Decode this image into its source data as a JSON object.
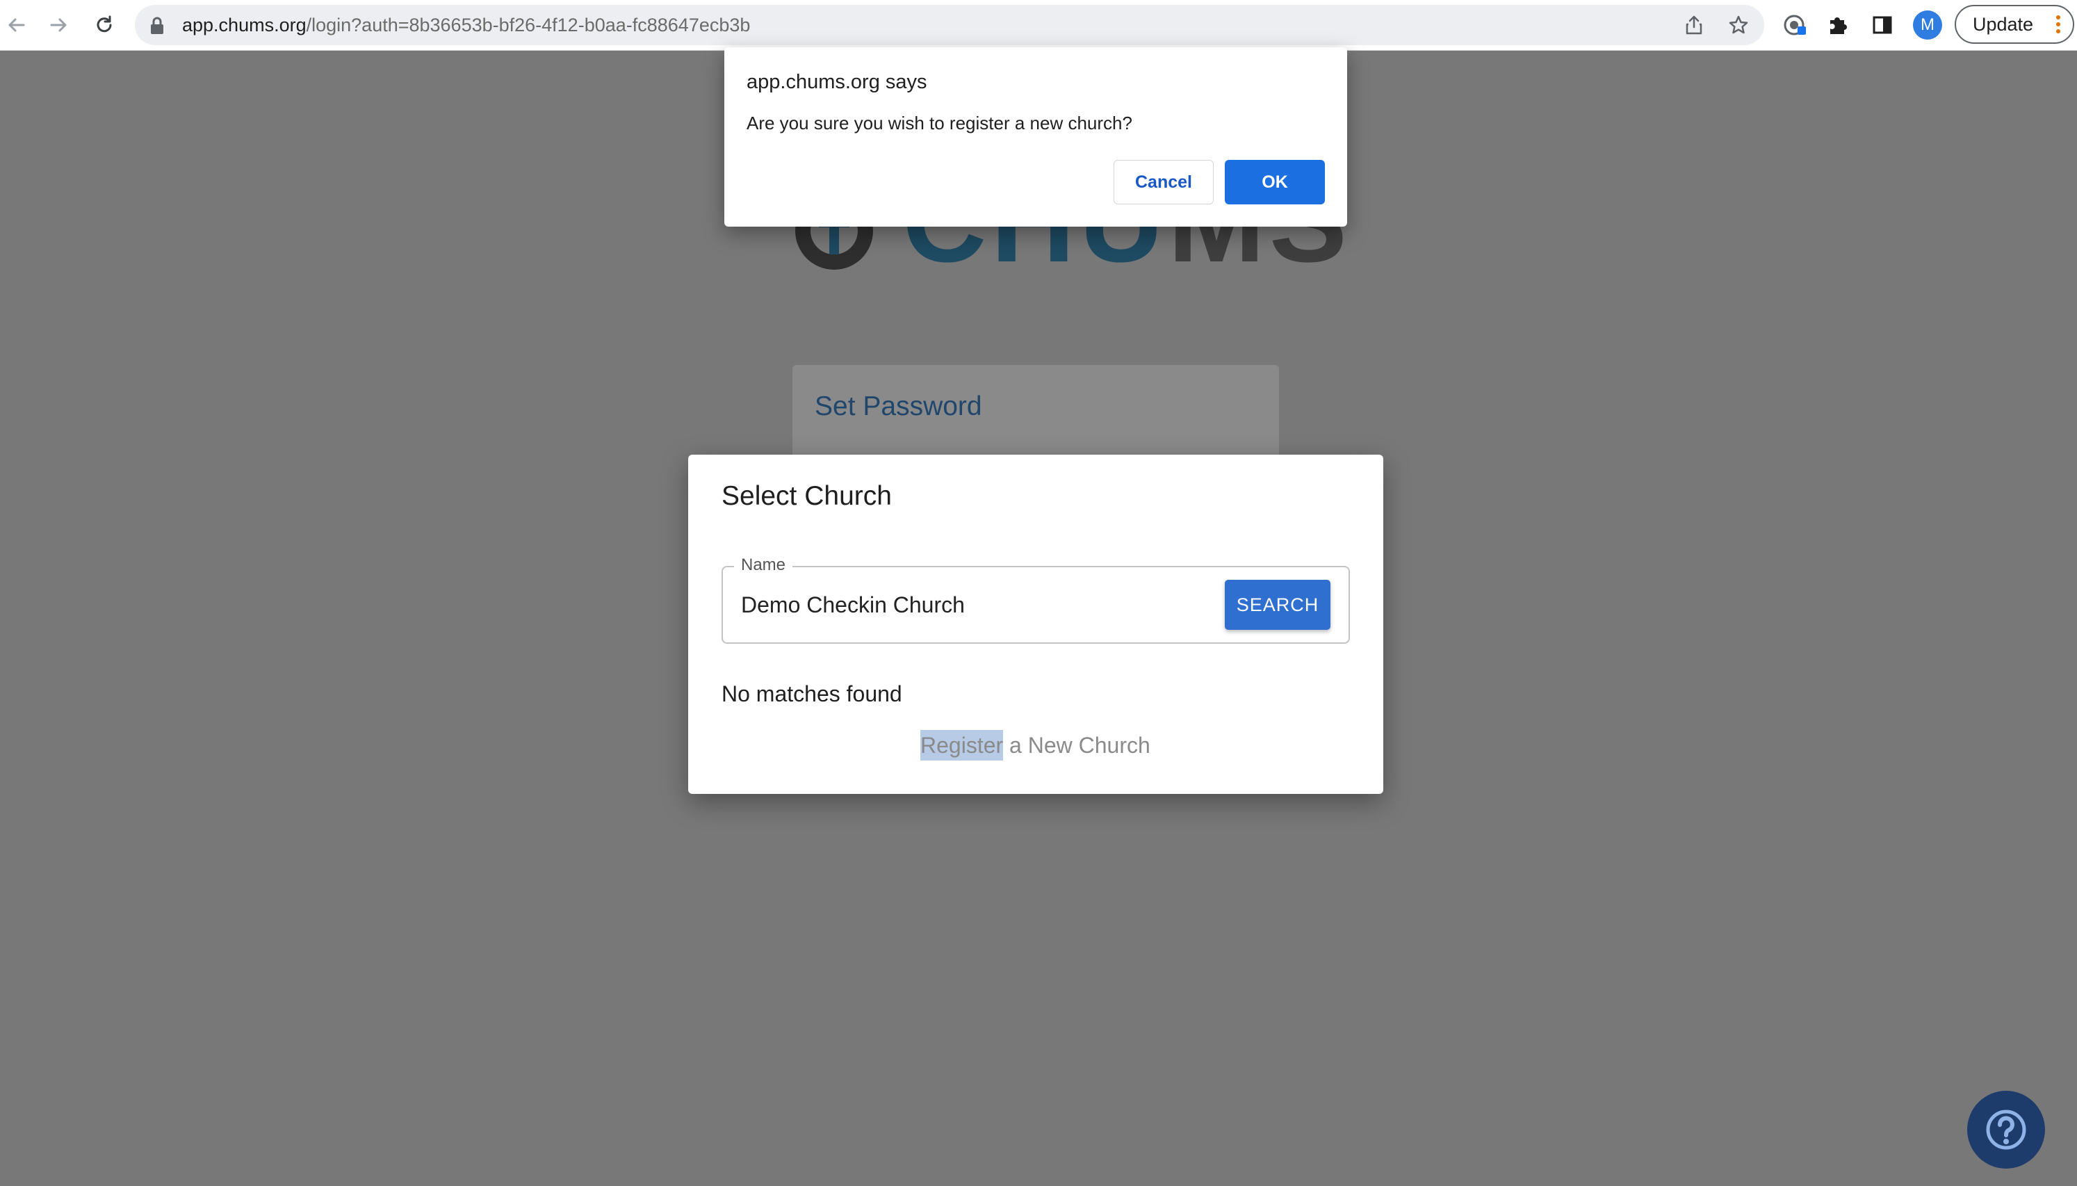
{
  "browser": {
    "url_host": "app.chums.org",
    "url_path": "/login?auth=8b36653b-bf26-4f12-b0aa-fc88647ecb3b",
    "profile_initial": "M",
    "update_label": "Update"
  },
  "page": {
    "logo": {
      "prefix": "CHU",
      "suffix": "MS"
    },
    "login_card": {
      "title": "Set Password"
    }
  },
  "select_church": {
    "title": "Select Church",
    "name_label": "Name",
    "name_value": "Demo Checkin Church",
    "search_label": "SEARCH",
    "no_matches": "No matches found",
    "register_highlight": "Register",
    "register_rest": " a New Church"
  },
  "alert": {
    "title": "app.chums.org says",
    "message": "Are you sure you wish to register a new church?",
    "cancel_label": "Cancel",
    "ok_label": "OK"
  },
  "icons": {
    "back": "back-arrow-icon",
    "forward": "forward-arrow-icon",
    "reload": "reload-icon",
    "lock": "lock-icon",
    "share": "share-icon",
    "bookmark": "star-icon",
    "extension_password": "password-manager-icon",
    "extensions": "puzzle-icon",
    "side_panel": "side-panel-icon",
    "menu": "kebab-menu-icon",
    "help": "question-mark-icon"
  },
  "colors": {
    "overlay": "#787878",
    "primary_button": "#2f6fd0",
    "alert_ok": "#1b6fe0",
    "help_button": "#1d3c6b",
    "highlight": "#b7cbe6"
  }
}
